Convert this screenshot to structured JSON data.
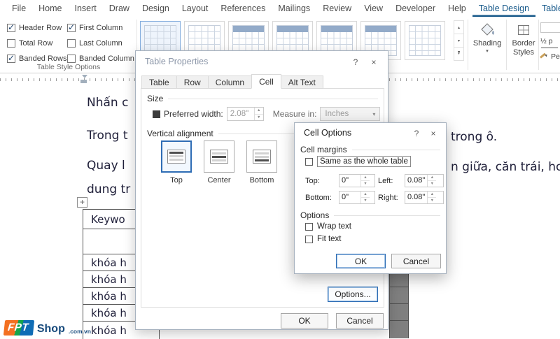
{
  "menubar": {
    "items": [
      {
        "label": "File"
      },
      {
        "label": "Home"
      },
      {
        "label": "Insert"
      },
      {
        "label": "Draw"
      },
      {
        "label": "Design"
      },
      {
        "label": "Layout"
      },
      {
        "label": "References"
      },
      {
        "label": "Mailings"
      },
      {
        "label": "Review"
      },
      {
        "label": "View"
      },
      {
        "label": "Developer"
      },
      {
        "label": "Help"
      },
      {
        "label": "Table Design"
      },
      {
        "label": "Table Layout"
      }
    ],
    "active_item": "Table Design"
  },
  "ribbon": {
    "style_options": {
      "group_label": "Table Style Options",
      "checkboxes": [
        {
          "label": "Header Row",
          "checked": true
        },
        {
          "label": "First Column",
          "checked": true
        },
        {
          "label": "Total Row",
          "checked": false
        },
        {
          "label": "Last Column",
          "checked": false
        },
        {
          "label": "Banded Rows",
          "checked": true
        },
        {
          "label": "Banded Column",
          "checked": false
        }
      ]
    },
    "shading": {
      "label": "Shading"
    },
    "border_styles": {
      "label_line1": "Border",
      "label_line2": "Styles"
    },
    "pen_weight_label": "½ p",
    "pen_color_label": "Pe"
  },
  "document": {
    "line1": "Nhấn c",
    "line2": "Trong t",
    "line2_right": "trong ô.",
    "line3": "Quay l",
    "line3_right": "n giữa, căn trái, ho",
    "line4": "dung tr",
    "table": {
      "header": "Keywo",
      "rows": [
        "",
        "khóa h",
        "khóa h",
        "khóa h",
        "khóa h",
        "khóa h"
      ]
    }
  },
  "table_properties_dialog": {
    "title": "Table Properties",
    "help_icon": "?",
    "close_icon": "×",
    "tabs": [
      {
        "label": "Table"
      },
      {
        "label": "Row"
      },
      {
        "label": "Column"
      },
      {
        "label": "Cell"
      },
      {
        "label": "Alt Text"
      }
    ],
    "active_tab": "Cell",
    "size_group_label": "Size",
    "preferred_width_label": "Preferred width:",
    "preferred_width_value": "2.08\"",
    "measure_in_label": "Measure in:",
    "measure_in_value": "Inches",
    "vertical_alignment_label": "Vertical alignment",
    "alignments": [
      {
        "label": "Top",
        "selected": true
      },
      {
        "label": "Center",
        "selected": false
      },
      {
        "label": "Bottom",
        "selected": false
      }
    ],
    "options_button_label": "Options...",
    "ok_label": "OK",
    "cancel_label": "Cancel"
  },
  "cell_options_dialog": {
    "title": "Cell Options",
    "help_icon": "?",
    "close_icon": "×",
    "cell_margins_label": "Cell margins",
    "same_as_table_label": "Same as the whole table",
    "same_as_table_checked": false,
    "margins": [
      {
        "label": "Top:",
        "value": "0\""
      },
      {
        "label": "Left:",
        "value": "0.08\""
      },
      {
        "label": "Bottom:",
        "value": "0\""
      },
      {
        "label": "Right:",
        "value": "0.08\""
      }
    ],
    "options_group_label": "Options",
    "wrap_text_label": "Wrap text",
    "wrap_text_checked": false,
    "fit_text_label": "Fit text",
    "fit_text_checked": false,
    "ok_label": "OK",
    "cancel_label": "Cancel"
  },
  "watermark": {
    "brand": "FPT",
    "name": "Shop",
    "suffix": ".com.vn"
  }
}
